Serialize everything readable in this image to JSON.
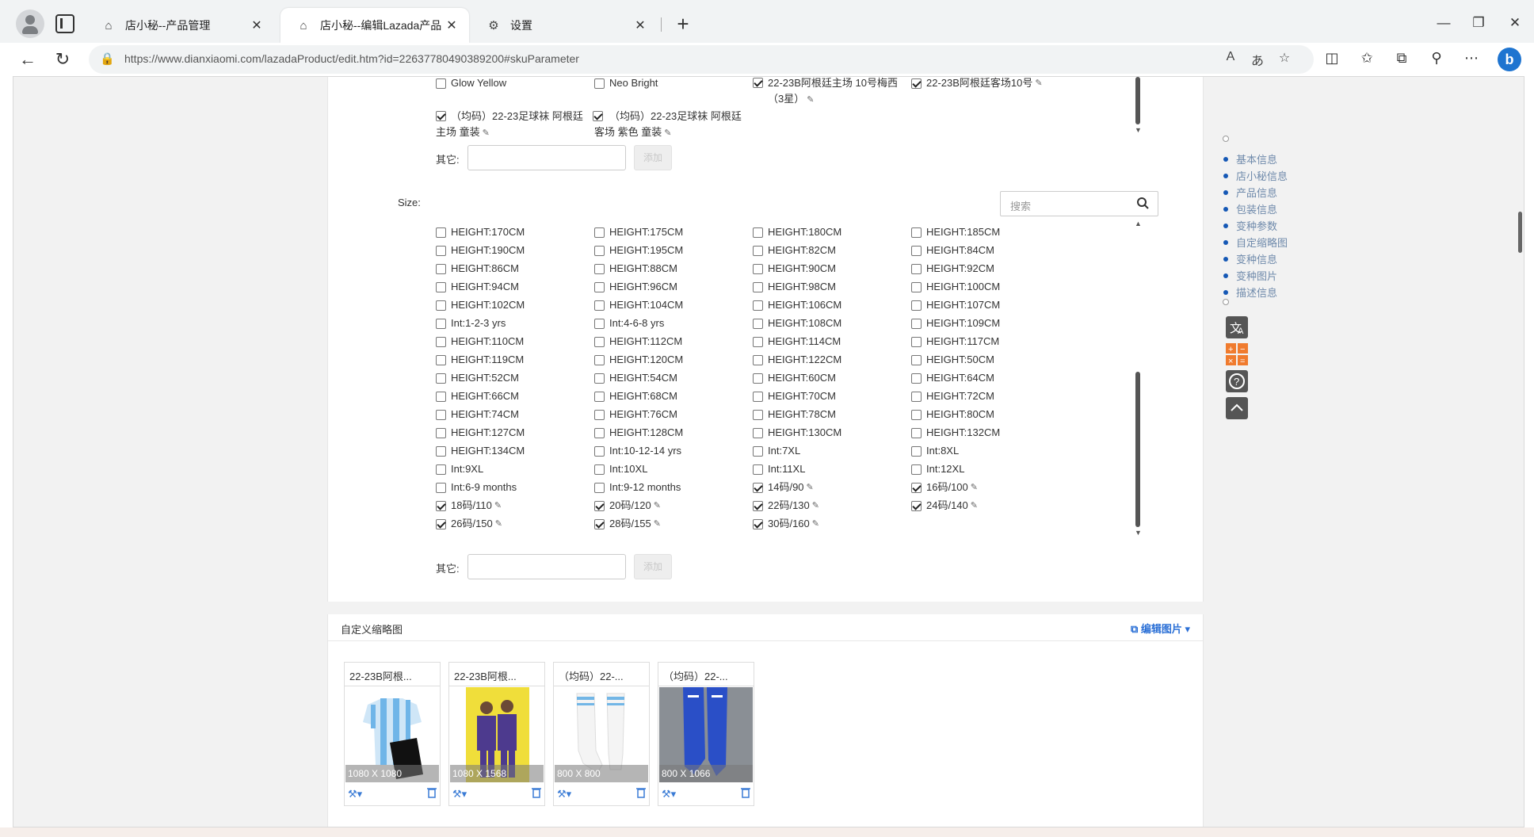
{
  "browser": {
    "tabs": [
      {
        "label": "店小秘--产品管理",
        "icon": "robot-icon"
      },
      {
        "label": "店小秘--编辑Lazada产品",
        "icon": "robot-icon",
        "active": true
      },
      {
        "label": "设置",
        "icon": "gear-icon"
      }
    ],
    "url": "https://www.dianxiaomi.com/lazadaProduct/edit.htm?id=22637780490389200#skuParameter"
  },
  "color_section": {
    "options": [
      {
        "label": "Glow Yellow",
        "checked": false
      },
      {
        "label": "Neo Bright",
        "checked": false
      },
      {
        "label": "22-23B阿根廷主场 10号梅西（3星）",
        "checked": true,
        "editable": true
      },
      {
        "label": "22-23B阿根廷客场10号",
        "checked": true,
        "editable": true
      },
      {
        "label": "（均码）22-23足球袜 阿根廷主场 童装",
        "checked": true,
        "editable": true
      },
      {
        "label": "（均码）22-23足球袜 阿根廷客场 紫色 童装",
        "checked": true,
        "editable": true
      }
    ],
    "other_label": "其它:",
    "add_label": "添加"
  },
  "size_section": {
    "label": "Size:",
    "search_placeholder": "搜索",
    "options": [
      {
        "label": "HEIGHT:170CM",
        "checked": false
      },
      {
        "label": "HEIGHT:175CM",
        "checked": false
      },
      {
        "label": "HEIGHT:180CM",
        "checked": false
      },
      {
        "label": "HEIGHT:185CM",
        "checked": false
      },
      {
        "label": "HEIGHT:190CM",
        "checked": false
      },
      {
        "label": "HEIGHT:195CM",
        "checked": false
      },
      {
        "label": "HEIGHT:82CM",
        "checked": false
      },
      {
        "label": "HEIGHT:84CM",
        "checked": false
      },
      {
        "label": "HEIGHT:86CM",
        "checked": false
      },
      {
        "label": "HEIGHT:88CM",
        "checked": false
      },
      {
        "label": "HEIGHT:90CM",
        "checked": false
      },
      {
        "label": "HEIGHT:92CM",
        "checked": false
      },
      {
        "label": "HEIGHT:94CM",
        "checked": false
      },
      {
        "label": "HEIGHT:96CM",
        "checked": false
      },
      {
        "label": "HEIGHT:98CM",
        "checked": false
      },
      {
        "label": "HEIGHT:100CM",
        "checked": false
      },
      {
        "label": "HEIGHT:102CM",
        "checked": false
      },
      {
        "label": "HEIGHT:104CM",
        "checked": false
      },
      {
        "label": "HEIGHT:106CM",
        "checked": false
      },
      {
        "label": "HEIGHT:107CM",
        "checked": false
      },
      {
        "label": "Int:1-2-3 yrs",
        "checked": false
      },
      {
        "label": "Int:4-6-8 yrs",
        "checked": false
      },
      {
        "label": "HEIGHT:108CM",
        "checked": false
      },
      {
        "label": "HEIGHT:109CM",
        "checked": false
      },
      {
        "label": "HEIGHT:110CM",
        "checked": false
      },
      {
        "label": "HEIGHT:112CM",
        "checked": false
      },
      {
        "label": "HEIGHT:114CM",
        "checked": false
      },
      {
        "label": "HEIGHT:117CM",
        "checked": false
      },
      {
        "label": "HEIGHT:119CM",
        "checked": false
      },
      {
        "label": "HEIGHT:120CM",
        "checked": false
      },
      {
        "label": "HEIGHT:122CM",
        "checked": false
      },
      {
        "label": "HEIGHT:50CM",
        "checked": false
      },
      {
        "label": "HEIGHT:52CM",
        "checked": false
      },
      {
        "label": "HEIGHT:54CM",
        "checked": false
      },
      {
        "label": "HEIGHT:60CM",
        "checked": false
      },
      {
        "label": "HEIGHT:64CM",
        "checked": false
      },
      {
        "label": "HEIGHT:66CM",
        "checked": false
      },
      {
        "label": "HEIGHT:68CM",
        "checked": false
      },
      {
        "label": "HEIGHT:70CM",
        "checked": false
      },
      {
        "label": "HEIGHT:72CM",
        "checked": false
      },
      {
        "label": "HEIGHT:74CM",
        "checked": false
      },
      {
        "label": "HEIGHT:76CM",
        "checked": false
      },
      {
        "label": "HEIGHT:78CM",
        "checked": false
      },
      {
        "label": "HEIGHT:80CM",
        "checked": false
      },
      {
        "label": "HEIGHT:127CM",
        "checked": false
      },
      {
        "label": "HEIGHT:128CM",
        "checked": false
      },
      {
        "label": "HEIGHT:130CM",
        "checked": false
      },
      {
        "label": "HEIGHT:132CM",
        "checked": false
      },
      {
        "label": "HEIGHT:134CM",
        "checked": false
      },
      {
        "label": "Int:10-12-14 yrs",
        "checked": false
      },
      {
        "label": "Int:7XL",
        "checked": false
      },
      {
        "label": "Int:8XL",
        "checked": false
      },
      {
        "label": "Int:9XL",
        "checked": false
      },
      {
        "label": "Int:10XL",
        "checked": false
      },
      {
        "label": "Int:11XL",
        "checked": false
      },
      {
        "label": "Int:12XL",
        "checked": false
      },
      {
        "label": "Int:6-9 months",
        "checked": false
      },
      {
        "label": "Int:9-12 months",
        "checked": false
      },
      {
        "label": "14码/90",
        "checked": true,
        "editable": true
      },
      {
        "label": "16码/100",
        "checked": true,
        "editable": true
      },
      {
        "label": "18码/110",
        "checked": true,
        "editable": true
      },
      {
        "label": "20码/120",
        "checked": true,
        "editable": true
      },
      {
        "label": "22码/130",
        "checked": true,
        "editable": true
      },
      {
        "label": "24码/140",
        "checked": true,
        "editable": true
      },
      {
        "label": "26码/150",
        "checked": true,
        "editable": true
      },
      {
        "label": "28码/155",
        "checked": true,
        "editable": true
      },
      {
        "label": "30码/160",
        "checked": true,
        "editable": true
      }
    ],
    "other_label": "其它:",
    "add_label": "添加"
  },
  "thumbnails": {
    "title": "自定义缩略图",
    "edit_label": "编辑图片",
    "items": [
      {
        "name": "22-23B阿根...",
        "dims": "1080 X 1080"
      },
      {
        "name": "22-23B阿根...",
        "dims": "1080 X 1568"
      },
      {
        "name": "（均码）22-...",
        "dims": "800 X 800"
      },
      {
        "name": "（均码）22-...",
        "dims": "800 X 1066"
      }
    ]
  },
  "sidebar": {
    "items": [
      "基本信息",
      "店小秘信息",
      "产品信息",
      "包装信息",
      "变种参数",
      "自定缩略图",
      "变种信息",
      "变种图片",
      "描述信息"
    ]
  }
}
